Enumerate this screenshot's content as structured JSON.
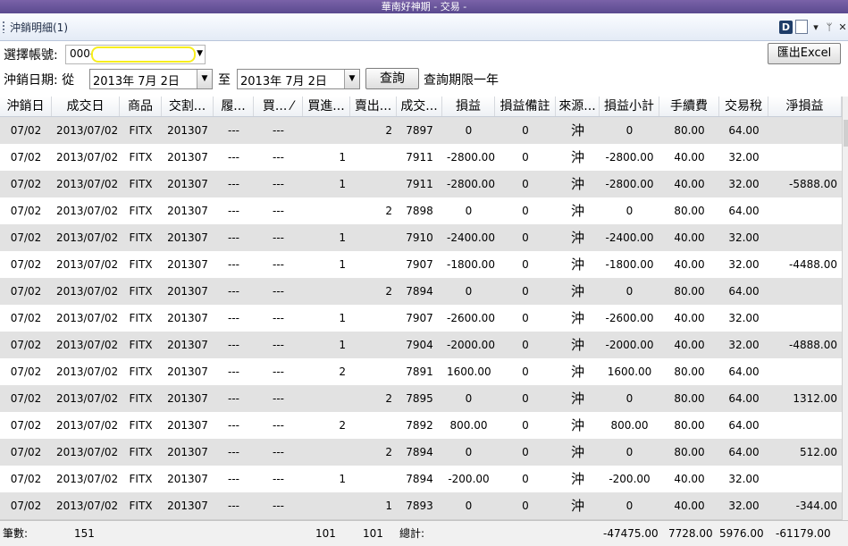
{
  "window": {
    "title": "華南好神期 - 交易 -"
  },
  "panel": {
    "title": "沖銷明細(1)",
    "icons": [
      "d-icon",
      "doc-icon",
      "pin-icon",
      "close-icon"
    ],
    "dropdown_glyph": "▾",
    "pin_glyph": "ᛘ",
    "close_glyph": "✕"
  },
  "account": {
    "label": "選擇帳號:",
    "value_prefix": "000-"
  },
  "export_button": "匯出Excel",
  "date_filter": {
    "label": "沖銷日期: 從",
    "from": "2013年  7月  2日",
    "to_label": "至",
    "to": "2013年  7月  2日",
    "query_button": "查詢",
    "note": "查詢期限一年"
  },
  "columns": [
    "沖銷日",
    "成交日",
    "商品",
    "交割...",
    "履...",
    "買... ⁄",
    "買進...",
    "賣出...",
    "成交...",
    "損益",
    "損益備註",
    "來源...",
    "損益小計",
    "手續費",
    "交易稅",
    "淨損益"
  ],
  "rows": [
    [
      "07/02",
      "2013/07/02",
      "FITX",
      "201307",
      "---",
      "---",
      "",
      "2",
      "7897",
      "0",
      "0",
      "沖",
      "0",
      "80.00",
      "64.00",
      ""
    ],
    [
      "07/02",
      "2013/07/02",
      "FITX",
      "201307",
      "---",
      "---",
      "1",
      "",
      "7911",
      "-2800.00",
      "0",
      "沖",
      "-2800.00",
      "40.00",
      "32.00",
      ""
    ],
    [
      "07/02",
      "2013/07/02",
      "FITX",
      "201307",
      "---",
      "---",
      "1",
      "",
      "7911",
      "-2800.00",
      "0",
      "沖",
      "-2800.00",
      "40.00",
      "32.00",
      "-5888.00"
    ],
    [
      "07/02",
      "2013/07/02",
      "FITX",
      "201307",
      "---",
      "---",
      "",
      "2",
      "7898",
      "0",
      "0",
      "沖",
      "0",
      "80.00",
      "64.00",
      ""
    ],
    [
      "07/02",
      "2013/07/02",
      "FITX",
      "201307",
      "---",
      "---",
      "1",
      "",
      "7910",
      "-2400.00",
      "0",
      "沖",
      "-2400.00",
      "40.00",
      "32.00",
      ""
    ],
    [
      "07/02",
      "2013/07/02",
      "FITX",
      "201307",
      "---",
      "---",
      "1",
      "",
      "7907",
      "-1800.00",
      "0",
      "沖",
      "-1800.00",
      "40.00",
      "32.00",
      "-4488.00"
    ],
    [
      "07/02",
      "2013/07/02",
      "FITX",
      "201307",
      "---",
      "---",
      "",
      "2",
      "7894",
      "0",
      "0",
      "沖",
      "0",
      "80.00",
      "64.00",
      ""
    ],
    [
      "07/02",
      "2013/07/02",
      "FITX",
      "201307",
      "---",
      "---",
      "1",
      "",
      "7907",
      "-2600.00",
      "0",
      "沖",
      "-2600.00",
      "40.00",
      "32.00",
      ""
    ],
    [
      "07/02",
      "2013/07/02",
      "FITX",
      "201307",
      "---",
      "---",
      "1",
      "",
      "7904",
      "-2000.00",
      "0",
      "沖",
      "-2000.00",
      "40.00",
      "32.00",
      "-4888.00"
    ],
    [
      "07/02",
      "2013/07/02",
      "FITX",
      "201307",
      "---",
      "---",
      "2",
      "",
      "7891",
      "1600.00",
      "0",
      "沖",
      "1600.00",
      "80.00",
      "64.00",
      ""
    ],
    [
      "07/02",
      "2013/07/02",
      "FITX",
      "201307",
      "---",
      "---",
      "",
      "2",
      "7895",
      "0",
      "0",
      "沖",
      "0",
      "80.00",
      "64.00",
      "1312.00"
    ],
    [
      "07/02",
      "2013/07/02",
      "FITX",
      "201307",
      "---",
      "---",
      "2",
      "",
      "7892",
      "800.00",
      "0",
      "沖",
      "800.00",
      "80.00",
      "64.00",
      ""
    ],
    [
      "07/02",
      "2013/07/02",
      "FITX",
      "201307",
      "---",
      "---",
      "",
      "2",
      "7894",
      "0",
      "0",
      "沖",
      "0",
      "80.00",
      "64.00",
      "512.00"
    ],
    [
      "07/02",
      "2013/07/02",
      "FITX",
      "201307",
      "---",
      "---",
      "1",
      "",
      "7894",
      "-200.00",
      "0",
      "沖",
      "-200.00",
      "40.00",
      "32.00",
      ""
    ],
    [
      "07/02",
      "2013/07/02",
      "FITX",
      "201307",
      "---",
      "---",
      "",
      "1",
      "7893",
      "0",
      "0",
      "沖",
      "0",
      "40.00",
      "32.00",
      "-344.00"
    ]
  ],
  "footer": {
    "count_label": "筆數:",
    "count": "151",
    "buy_total": "101",
    "sell_total": "101",
    "total_label": "總計:",
    "pnl_subtotal": "-47475.00",
    "fee_total": "7728.00",
    "tax_total": "5976.00",
    "net_total": "-61179.00"
  }
}
